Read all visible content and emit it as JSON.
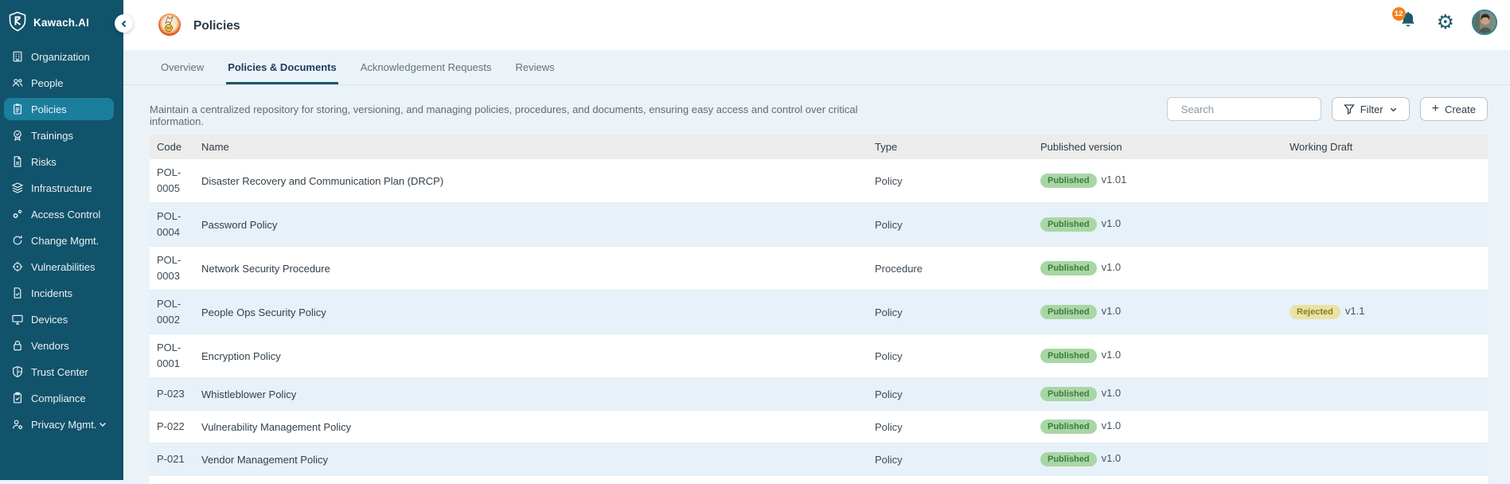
{
  "app": {
    "name": "Kawach.AI"
  },
  "sidebar": {
    "items": [
      {
        "label": "Organization"
      },
      {
        "label": "People"
      },
      {
        "label": "Policies",
        "active": true
      },
      {
        "label": "Trainings"
      },
      {
        "label": "Risks"
      },
      {
        "label": "Infrastructure"
      },
      {
        "label": "Access Control"
      },
      {
        "label": "Change Mgmt."
      },
      {
        "label": "Vulnerabilities"
      },
      {
        "label": "Incidents"
      },
      {
        "label": "Devices"
      },
      {
        "label": "Vendors"
      },
      {
        "label": "Trust Center"
      },
      {
        "label": "Compliance"
      },
      {
        "label": "Privacy Mgmt.",
        "expandable": true
      }
    ]
  },
  "header": {
    "title": "Policies",
    "notifications_count": "12"
  },
  "tabs": [
    {
      "label": "Overview"
    },
    {
      "label": "Policies & Documents",
      "active": true
    },
    {
      "label": "Acknowledgement Requests"
    },
    {
      "label": "Reviews"
    }
  ],
  "description": "Maintain a centralized repository for storing, versioning, and managing policies, procedures, and documents, ensuring easy access and control over critical information.",
  "toolbar": {
    "search_placeholder": "Search",
    "filter_label": "Filter",
    "create_label": "Create",
    "create_plus": "+"
  },
  "table": {
    "columns": [
      "Code",
      "Name",
      "Type",
      "Published version",
      "Working Draft"
    ],
    "rows": [
      {
        "code": "POL-0005",
        "name": "Disaster Recovery and Communication Plan (DRCP)",
        "type": "Policy",
        "published": {
          "badge": "Published",
          "version": "v1.01"
        }
      },
      {
        "code": "POL-0004",
        "name": "Password Policy",
        "type": "Policy",
        "published": {
          "badge": "Published",
          "version": "v1.0"
        }
      },
      {
        "code": "POL-0003",
        "name": "Network Security Procedure",
        "type": "Procedure",
        "published": {
          "badge": "Published",
          "version": "v1.0"
        }
      },
      {
        "code": "POL-0002",
        "name": "People Ops Security Policy",
        "type": "Policy",
        "published": {
          "badge": "Published",
          "version": "v1.0"
        },
        "working_draft": {
          "badge": "Rejected",
          "version": "v1.1"
        }
      },
      {
        "code": "POL-0001",
        "name": "Encryption Policy",
        "type": "Policy",
        "published": {
          "badge": "Published",
          "version": "v1.0"
        }
      },
      {
        "code": "P-023",
        "name": "Whistleblower Policy",
        "type": "Policy",
        "published": {
          "badge": "Published",
          "version": "v1.0"
        }
      },
      {
        "code": "P-022",
        "name": "Vulnerability Management Policy",
        "type": "Policy",
        "published": {
          "badge": "Published",
          "version": "v1.0"
        }
      },
      {
        "code": "P-021",
        "name": "Vendor Management Policy",
        "type": "Policy",
        "published": {
          "badge": "Published",
          "version": "v1.0"
        }
      }
    ]
  },
  "colors": {
    "sidebar_bg": "#11536a",
    "sidebar_active": "#1b7e9d",
    "accent_teal": "#14586c",
    "published_badge_bg": "#a9d6a5",
    "published_badge_text": "#3c7d3e",
    "rejected_badge_bg": "#e9e3a6",
    "rejected_badge_text": "#8e7d1c",
    "notification_badge": "#f2811d",
    "content_bg": "#ebf3f8",
    "row_alt_bg": "#e7f1fa"
  }
}
